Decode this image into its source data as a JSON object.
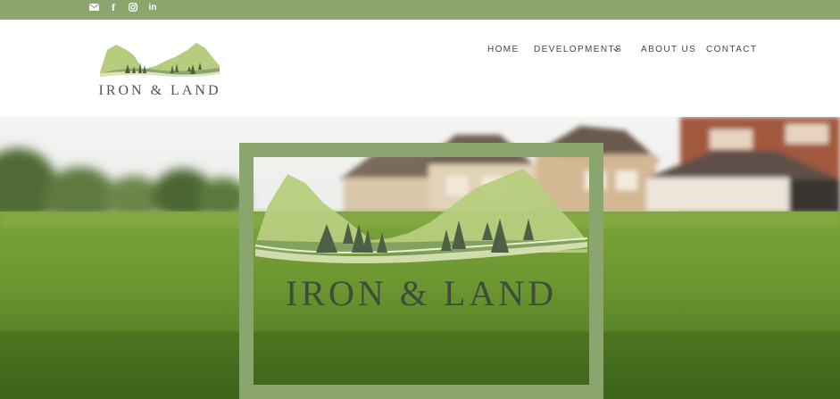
{
  "topbar": {
    "icons": [
      "email-icon",
      "facebook-icon",
      "instagram-icon",
      "linkedin-icon"
    ],
    "facebook_glyph": "f",
    "linkedin_glyph": "in",
    "color": "#8aa66e"
  },
  "header": {
    "logo_text": "IRON & LAND",
    "nav": {
      "home": "HOME",
      "developments": "DEVELOPMENTS",
      "about": "ABOUT US",
      "contact": "CONTACT"
    }
  },
  "hero": {
    "logo_text": "IRON & LAND",
    "frame_color": "#8aa66e"
  },
  "colors": {
    "accent": "#8aa66e",
    "mountain_light": "#b6cd7e",
    "tree_dark": "#4d5f44",
    "text_dark": "#3d4a38"
  }
}
